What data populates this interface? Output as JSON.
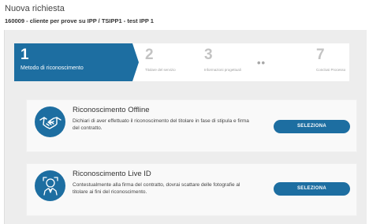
{
  "header": {
    "title": "Nuova richiesta",
    "subtitle": "160009 - cliente per prove su IPP  / TSIPP1 - test IPP 1"
  },
  "stepper": {
    "steps": [
      {
        "number": "1",
        "label": "Metodo di riconoscimento",
        "active": true
      },
      {
        "number": "2",
        "label": "Titolare del servizio",
        "active": false
      },
      {
        "number": "3",
        "label": "Informazioni progettuali",
        "active": false
      },
      {
        "number": "7",
        "label": "Conclusi Processo",
        "active": false
      }
    ],
    "ellipsis": "••"
  },
  "cards": [
    {
      "title": "Riconoscimento Offline",
      "description": "Dichiari di aver effettuato il riconoscimento del titolare in fase di stipula e firma del contratto.",
      "button": "SELEZIONA",
      "icon": "handshake-icon"
    },
    {
      "title": "Riconoscimento Live ID",
      "description": "Contestualmente alla firma del contratto, dovrai scattare delle fotografie al titolare ai fini del riconoscimento.",
      "button": "SELEZIONA",
      "icon": "person-id-icon"
    }
  ],
  "colors": {
    "accent": "#1d6ea1",
    "panel_bg": "#ededed"
  }
}
